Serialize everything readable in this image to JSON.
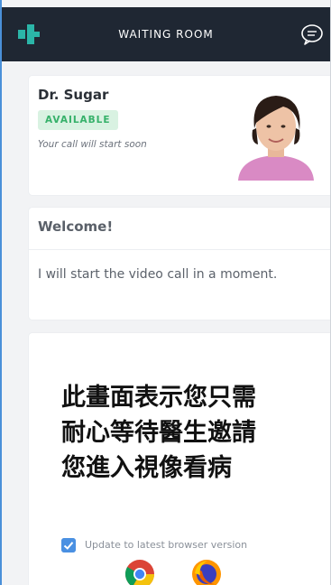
{
  "header": {
    "title": "WAITING ROOM",
    "brand_icon": "clinic-logo-icon",
    "chat_icon": "chat-bubble-icon",
    "background": "#1f2733"
  },
  "doctor": {
    "name": "Dr. Sugar",
    "status_badge": "AVAILABLE",
    "status_text": "Your call will start soon",
    "badge_color": "#36b16a"
  },
  "welcome": {
    "heading": "Welcome!",
    "message": "I will start the video call in a moment."
  },
  "notice": {
    "caption_lines": [
      "此畫面表示您只需",
      "耐心等待醫生邀請",
      "您進入視像看病"
    ],
    "checkbox_label": "Update to latest browser version",
    "browsers": [
      "chrome-icon",
      "firefox-icon"
    ]
  }
}
